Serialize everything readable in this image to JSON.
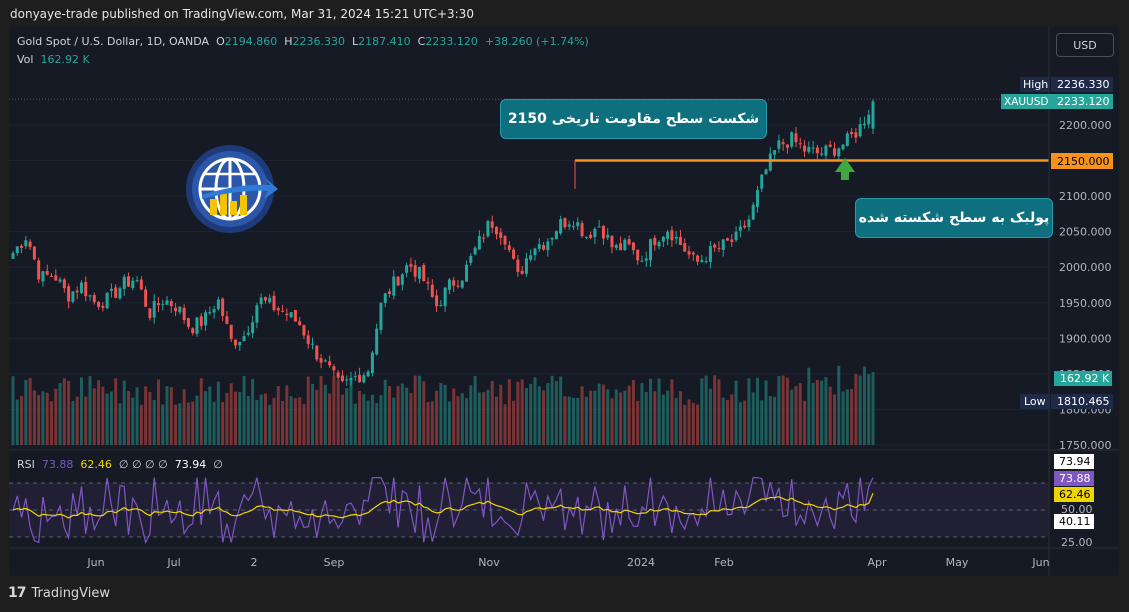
{
  "header": {
    "published_line": "donyaye-trade published on TradingView.com, Mar 31, 2024 15:21 UTC+3:30"
  },
  "legend": {
    "symbol": "Gold Spot / U.S. Dollar, 1D, OANDA",
    "o_label": "O",
    "o_value": "2194.860",
    "h_label": "H",
    "h_value": "2236.330",
    "l_label": "L",
    "l_value": "2187.410",
    "c_label": "C",
    "c_value": "2233.120",
    "change": "+38.260 (+1.74%)",
    "vol_label": "Vol",
    "vol_value": "162.92 K"
  },
  "currency_button": "USD",
  "price_axis": {
    "ticks": [
      "2200.000",
      "2150.000",
      "2100.000",
      "2050.000",
      "2000.000",
      "1950.000",
      "1900.000",
      "1850.000",
      "1800.000",
      "1750.000"
    ],
    "high_label": "High",
    "high_value": "2236.330",
    "symbol_label": "XAUUSD",
    "last_value": "2233.120",
    "level_value": "2150.000",
    "vol_badge": "162.92 K",
    "low_label": "Low",
    "low_value": "1810.465"
  },
  "rsi": {
    "label": "RSI",
    "v1": "73.88",
    "v2": "62.46",
    "placeholders": "∅ ∅ ∅ ∅",
    "v3": "73.94",
    "v4": "∅",
    "axis_ticks": [
      "50.00",
      "25.00"
    ],
    "badges": {
      "a": "73.94",
      "b": "73.88",
      "c": "62.46",
      "d": "40.11"
    }
  },
  "time_axis": [
    "Jun",
    "Jul",
    "2",
    "Sep",
    "Nov",
    "2024",
    "Feb",
    "Apr",
    "May",
    "Jun"
  ],
  "annotations": {
    "breakout": "شکست سطح مقاومت تاریخی 2150",
    "pullback": "پولبک به سطح شکسته شده"
  },
  "footer": {
    "brand": "TradingView"
  },
  "colors": {
    "up": "#26a69a",
    "down": "#ef5350",
    "level": "#f7931a",
    "rsi": "#7e57c2",
    "rsi_ma": "#f0d400",
    "callout": "#0e6f7e"
  },
  "chart_data": {
    "type": "candlestick",
    "symbol": "XAUUSD",
    "timeframe": "1D",
    "price_range": [
      1750,
      2240
    ],
    "horizontal_level": 2150,
    "last_ohlc": {
      "open": 2194.86,
      "high": 2236.33,
      "low": 2187.41,
      "close": 2233.12
    },
    "approx_path_closes": [
      2020,
      2045,
      1985,
      1990,
      1960,
      1975,
      1950,
      1955,
      1975,
      1985,
      1935,
      1955,
      1945,
      1915,
      1925,
      1955,
      1895,
      1905,
      1955,
      1945,
      1935,
      1920,
      1885,
      1860,
      1830,
      1845,
      1855,
      1950,
      1980,
      2005,
      1985,
      1945,
      1975,
      1990,
      2030,
      2065,
      2045,
      1985,
      2030,
      2035,
      2060,
      2070,
      2045,
      2060,
      2025,
      2030,
      2010,
      2040,
      2055,
      2030,
      2005,
      2020,
      2030,
      2040,
      2070,
      2130,
      2170,
      2180,
      2165,
      2160,
      2165,
      2175,
      2195,
      2233
    ],
    "rsi": {
      "last": 73.88,
      "ma": 62.46,
      "bands": [
        30,
        50,
        70
      ]
    }
  }
}
